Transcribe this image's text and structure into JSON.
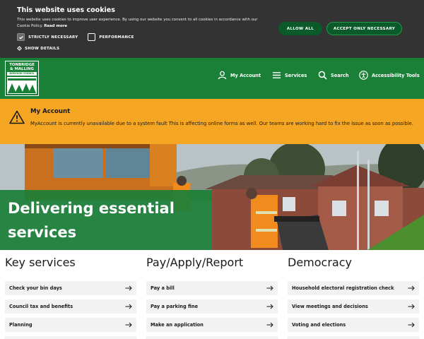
{
  "cookie": {
    "title": "This website uses cookies",
    "text": "This website uses cookies to improve user experience. By using our website you consent to all cookies in accordance with our Cookie Policy.",
    "read_more": "Read more",
    "strictly_necessary": "STRICTLY NECESSARY",
    "performance": "PERFORMANCE",
    "show_details": "SHOW DETAILS",
    "allow_all": "ALLOW ALL",
    "accept_necessary": "ACCEPT ONLY NECESSARY",
    "strictly_checked": true,
    "performance_checked": false
  },
  "header": {
    "logo_line1": "TONBRIDGE",
    "logo_line2": "& MALLING",
    "logo_sub": "BOROUGH COUNCIL",
    "nav": {
      "account": "My Account",
      "services": "Services",
      "search": "Search",
      "accessibility": "Accessibility Tools"
    }
  },
  "alert": {
    "title": "My Account",
    "message": "MyAccount is currently unavailable due to a system fault This is affecting online forms as well. Our teams are working hard to fix the issue as soon as possible."
  },
  "hero": {
    "title": "Delivering essential services"
  },
  "columns": [
    {
      "heading": "Key services",
      "links": [
        "Check your bin days",
        "Council tax and benefits",
        "Planning",
        ""
      ]
    },
    {
      "heading": "Pay/Apply/Report",
      "links": [
        "Pay a bill",
        "Pay a parking fine",
        "Make an application",
        ""
      ]
    },
    {
      "heading": "Democracy",
      "links": [
        "Household electoral registration check",
        "View meetings and decisions",
        "Voting and elections",
        ""
      ]
    }
  ],
  "colors": {
    "brand_green": "#1a7f37",
    "alert_amber": "#f5a623",
    "cookie_bg": "#333333",
    "button_green": "#0a5a2a"
  }
}
